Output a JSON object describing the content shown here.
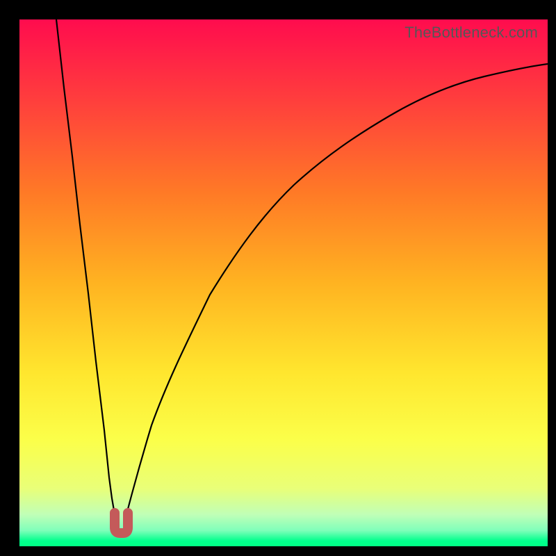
{
  "watermark_text": "TheBottleneck.com",
  "colors": {
    "frame_bg": "#000000",
    "gradient_top": "#ff0c4e",
    "gradient_bottom": "#00ff85",
    "marker": "#c45a5a",
    "curve": "#000000"
  },
  "chart_data": {
    "type": "line",
    "title": "",
    "xlabel": "",
    "ylabel": "",
    "xlim": [
      0,
      100
    ],
    "ylim": [
      0,
      100
    ],
    "series": [
      {
        "name": "left-branch",
        "x": [
          7.0,
          8.5,
          10.0,
          11.5,
          13.0,
          14.5,
          16.0,
          17.0,
          17.5,
          18.0,
          18.5
        ],
        "values": [
          100.0,
          87.0,
          74.0,
          61.0,
          48.0,
          35.0,
          22.0,
          13.0,
          9.0,
          6.0,
          5.0
        ]
      },
      {
        "name": "right-branch",
        "x": [
          20.0,
          22.0,
          25.0,
          28.0,
          32.0,
          36.0,
          41.0,
          46.0,
          52.0,
          58.0,
          64.0,
          70.0,
          77.0,
          84.0,
          91.0,
          100.0
        ],
        "values": [
          5.0,
          12.0,
          23.0,
          32.0,
          42.0,
          50.0,
          58.0,
          64.0,
          70.0,
          75.0,
          79.0,
          83.0,
          86.0,
          88.0,
          90.0,
          91.5
        ]
      }
    ],
    "trough_marker": {
      "x": 19.2,
      "y_min": 3.0,
      "y_max": 6.0
    },
    "grid": false,
    "legend": false
  }
}
